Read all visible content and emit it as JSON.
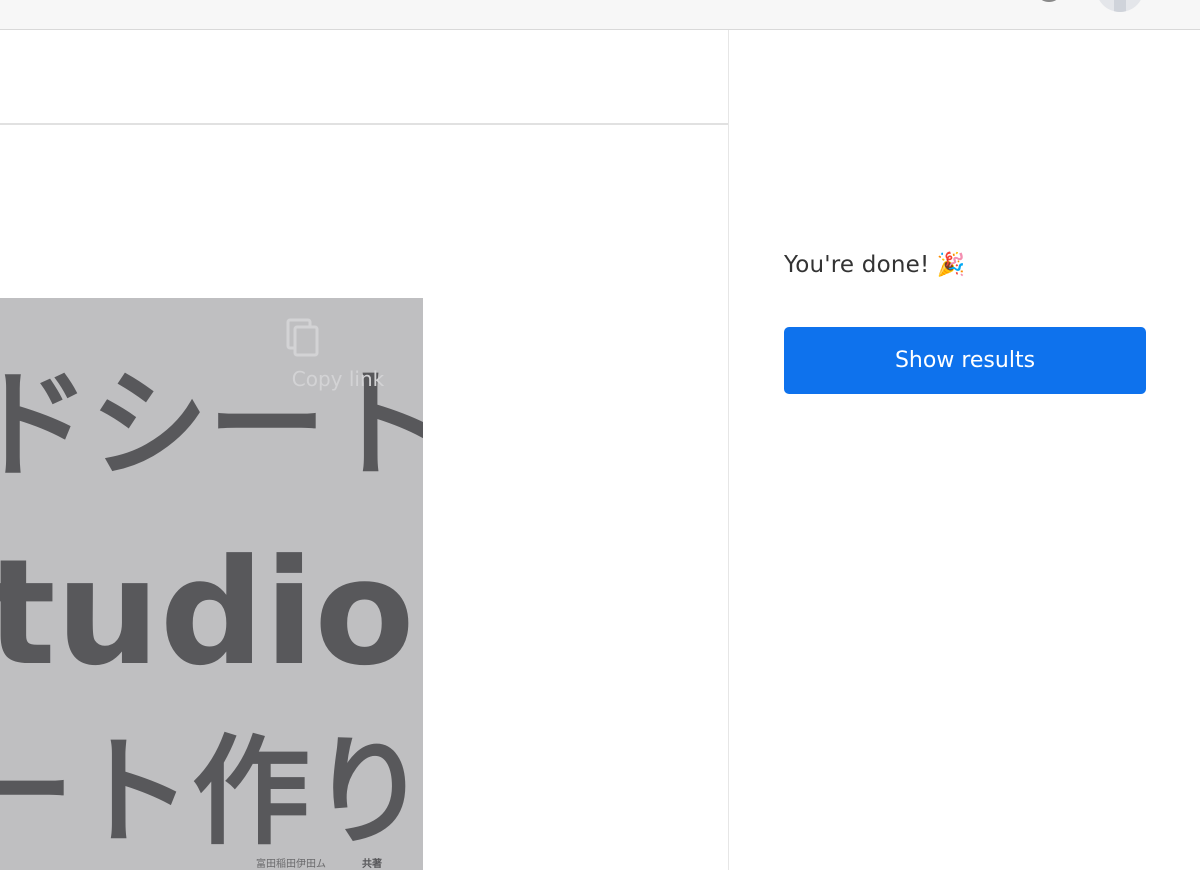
{
  "topbar": {
    "help_icon": "help-circle-icon",
    "avatar_icon": "user-avatar"
  },
  "sidebar": {
    "done_text": "You're done! 🎉",
    "show_results_label": "Show results"
  },
  "thumbnail": {
    "line1": "ドシート",
    "line2": "tudio",
    "line3": "ート作り",
    "footer_left": "富田稲田伊田ム",
    "footer_right": "共著",
    "copy_link_label": "Copy link",
    "copy_icon": "copy-icon"
  },
  "colors": {
    "accent": "#0e72ed",
    "thumbnail_bg": "#bfbfc1",
    "thumbnail_text": "#58585b"
  }
}
